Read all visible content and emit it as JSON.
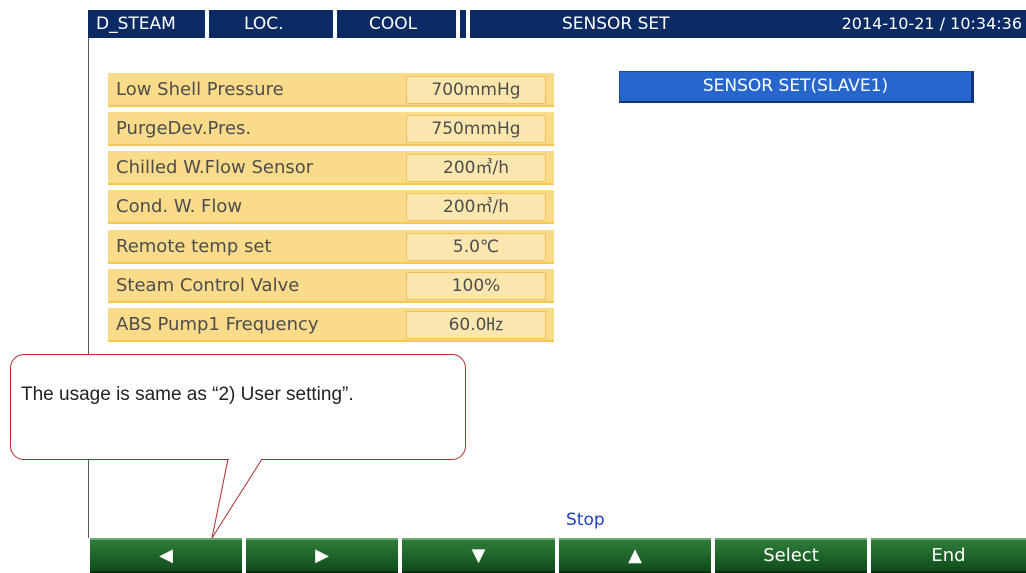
{
  "header": {
    "mode": "D_STEAM",
    "location": "LOC.",
    "operation": "COOL",
    "title": "SENSOR SET",
    "datetime": "2014-10-21 / 10:34:36"
  },
  "sensor_rows": [
    {
      "label": "Low Shell Pressure",
      "value": "700mmHg"
    },
    {
      "label": "PurgeDev.Pres.",
      "value": "750mmHg"
    },
    {
      "label": "Chilled W.Flow Sensor",
      "value": "200㎥/h"
    },
    {
      "label": "Cond. W. Flow",
      "value": "200㎥/h"
    },
    {
      "label": "Remote temp set",
      "value": "5.0℃"
    },
    {
      "label": "Steam Control Valve",
      "value": "100%"
    },
    {
      "label": "ABS Pump1 Frequency",
      "value": "60.0㎐"
    }
  ],
  "slave_button": "SENSOR SET(SLAVE1)",
  "callout": "The usage is same as “2) User setting”.",
  "status": "Stop",
  "buttons": [
    {
      "label": "◀",
      "icon": "left-arrow-icon"
    },
    {
      "label": "▶",
      "icon": "right-arrow-icon"
    },
    {
      "label": "▼",
      "icon": "down-arrow-icon"
    },
    {
      "label": "▲",
      "icon": "up-arrow-icon"
    },
    {
      "label": "Select"
    },
    {
      "label": "End"
    }
  ]
}
